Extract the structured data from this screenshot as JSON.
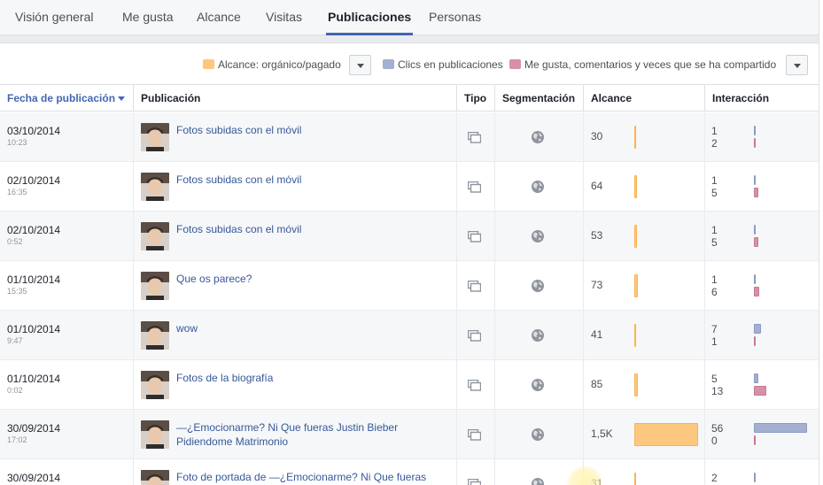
{
  "tabs": [
    "Visión general",
    "Me gusta",
    "Alcance",
    "Visitas",
    "Publicaciones",
    "Personas"
  ],
  "active_tab": "Publicaciones",
  "legend": {
    "reach": "Alcance: orgánico/pagado",
    "clicks": "Clics en publicaciones",
    "likes": "Me gusta, comentarios y veces que se ha compartido"
  },
  "colors": {
    "reach": "#fcc77e",
    "clicks": "#a3b0d0",
    "likes": "#d591a6",
    "accent": "#4267b2"
  },
  "columns": {
    "date": "Fecha de publicación",
    "post": "Publicación",
    "type": "Tipo",
    "targeting": "Segmentación",
    "reach": "Alcance",
    "interaction": "Interacción"
  },
  "rows": [
    {
      "date": "03/10/2014",
      "time": "10:23",
      "post": "Fotos subidas con el móvil",
      "type_icon": "photo-album-icon",
      "targeting_icon": "globe-icon",
      "reach": "30",
      "reach_value": 30,
      "clicks": "1",
      "clicks_value": 1,
      "likes": "2",
      "likes_value": 2
    },
    {
      "date": "02/10/2014",
      "time": "16:35",
      "post": "Fotos subidas con el móvil",
      "type_icon": "photo-album-icon",
      "targeting_icon": "globe-icon",
      "reach": "64",
      "reach_value": 64,
      "clicks": "1",
      "clicks_value": 1,
      "likes": "5",
      "likes_value": 5
    },
    {
      "date": "02/10/2014",
      "time": "0:52",
      "post": "Fotos subidas con el móvil",
      "type_icon": "photo-album-icon",
      "targeting_icon": "globe-icon",
      "reach": "53",
      "reach_value": 53,
      "clicks": "1",
      "clicks_value": 1,
      "likes": "5",
      "likes_value": 5
    },
    {
      "date": "01/10/2014",
      "time": "15:35",
      "post": "Que os parece?",
      "type_icon": "photo-album-icon",
      "targeting_icon": "globe-icon",
      "reach": "73",
      "reach_value": 73,
      "clicks": "1",
      "clicks_value": 1,
      "likes": "6",
      "likes_value": 6
    },
    {
      "date": "01/10/2014",
      "time": "9:47",
      "post": "wow",
      "type_icon": "photo-album-icon",
      "targeting_icon": "globe-icon",
      "reach": "41",
      "reach_value": 41,
      "clicks": "7",
      "clicks_value": 7,
      "likes": "1",
      "likes_value": 1
    },
    {
      "date": "01/10/2014",
      "time": "0:02",
      "post": "Fotos de la biografía",
      "type_icon": "photo-album-icon",
      "targeting_icon": "globe-icon",
      "reach": "85",
      "reach_value": 85,
      "clicks": "5",
      "clicks_value": 5,
      "likes": "13",
      "likes_value": 13
    },
    {
      "date": "30/09/2014",
      "time": "17:02",
      "post": "—¿Emocionarme? Ni Que fueras Justin Bieber Pidiendome Matrimonio",
      "type_icon": "photo-album-icon",
      "targeting_icon": "globe-icon",
      "reach": "1,5K",
      "reach_value": 1500,
      "clicks": "56",
      "clicks_value": 56,
      "likes": "0",
      "likes_value": 0
    },
    {
      "date": "30/09/2014",
      "time": "",
      "post": "Foto de portada de —¿Emocionarme? Ni Que fueras",
      "type_icon": "photo-album-icon",
      "targeting_icon": "globe-icon",
      "reach": "31",
      "reach_value": 31,
      "clicks": "2",
      "clicks_value": 2,
      "likes": "",
      "likes_value": 0
    }
  ]
}
